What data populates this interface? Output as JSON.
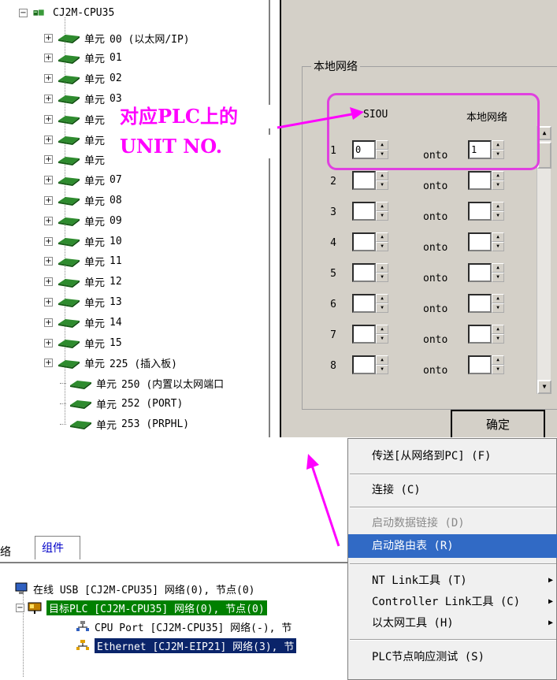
{
  "tree": {
    "root": "CJ2M-CPU35",
    "units": [
      {
        "label": "单元",
        "num": "00 (以太网/IP)"
      },
      {
        "label": "单元",
        "num": "01"
      },
      {
        "label": "单元",
        "num": "02"
      },
      {
        "label": "单元",
        "num": "03"
      },
      {
        "label": "单元",
        "num": ""
      },
      {
        "label": "单元",
        "num": ""
      },
      {
        "label": "单元",
        "num": ""
      },
      {
        "label": "单元",
        "num": "07"
      },
      {
        "label": "单元",
        "num": "08"
      },
      {
        "label": "单元",
        "num": "09"
      },
      {
        "label": "单元",
        "num": "10"
      },
      {
        "label": "单元",
        "num": "11"
      },
      {
        "label": "单元",
        "num": "12"
      },
      {
        "label": "单元",
        "num": "13"
      },
      {
        "label": "单元",
        "num": "14"
      },
      {
        "label": "单元",
        "num": "15"
      },
      {
        "label": "单元",
        "num": "225 (插入板)"
      },
      {
        "label": "单元",
        "num": "250 (内置以太网端口"
      },
      {
        "label": "单元",
        "num": "252 (PORT)"
      },
      {
        "label": "单元",
        "num": "253 (PRPHL)"
      }
    ]
  },
  "annotation": {
    "line1": "对应PLC上的",
    "line2": "UNIT NO."
  },
  "dialog": {
    "group_title": "本地网络",
    "col_siou": "SIOU",
    "col_local": "本地网络",
    "onto": "onto",
    "rows": [
      {
        "n": "1",
        "siou": "0",
        "local": "1"
      },
      {
        "n": "2",
        "siou": "",
        "local": ""
      },
      {
        "n": "3",
        "siou": "",
        "local": ""
      },
      {
        "n": "4",
        "siou": "",
        "local": ""
      },
      {
        "n": "5",
        "siou": "",
        "local": ""
      },
      {
        "n": "6",
        "siou": "",
        "local": ""
      },
      {
        "n": "7",
        "siou": "",
        "local": ""
      },
      {
        "n": "8",
        "siou": "",
        "local": ""
      }
    ],
    "ok": "确定"
  },
  "bottom": {
    "tab_fragment": "络",
    "tab_active": "组件",
    "rows": [
      "在线 USB  [CJ2M-CPU35] 网络(0), 节点(0)",
      "目标PLC [CJ2M-CPU35] 网络(0), 节点(0)",
      "CPU Port [CJ2M-CPU35] 网络(-), 节",
      "Ethernet [CJ2M-EIP21] 网络(3), 节"
    ]
  },
  "menu": {
    "items": [
      {
        "label": "传送[从网络到PC] (F)",
        "state": "normal"
      },
      {
        "label": "连接 (C)",
        "state": "normal"
      },
      {
        "label": "启动数据链接 (D)",
        "state": "disabled"
      },
      {
        "label": "启动路由表 (R)",
        "state": "highlighted"
      },
      {
        "label": "NT Link工具 (T)",
        "state": "submenu"
      },
      {
        "label": "Controller Link工具 (C)",
        "state": "submenu"
      },
      {
        "label": "以太网工具 (H)",
        "state": "submenu"
      },
      {
        "label": "PLC节点响应测试 (S)",
        "state": "normal"
      }
    ],
    "submenu_arrow": "▶"
  },
  "colors": {
    "annotation": "#ff00ff",
    "dialog_bg": "#d4d0c8",
    "menu_highlight": "#316ac5",
    "target_plc_bg": "#008000",
    "ethernet_sel_bg": "#0a246a"
  },
  "icons": [
    "minus-box-icon",
    "plus-box-icon",
    "cpu-icon",
    "unit-module-icon",
    "monitor-icon",
    "plc-icon",
    "network-port-icon"
  ]
}
